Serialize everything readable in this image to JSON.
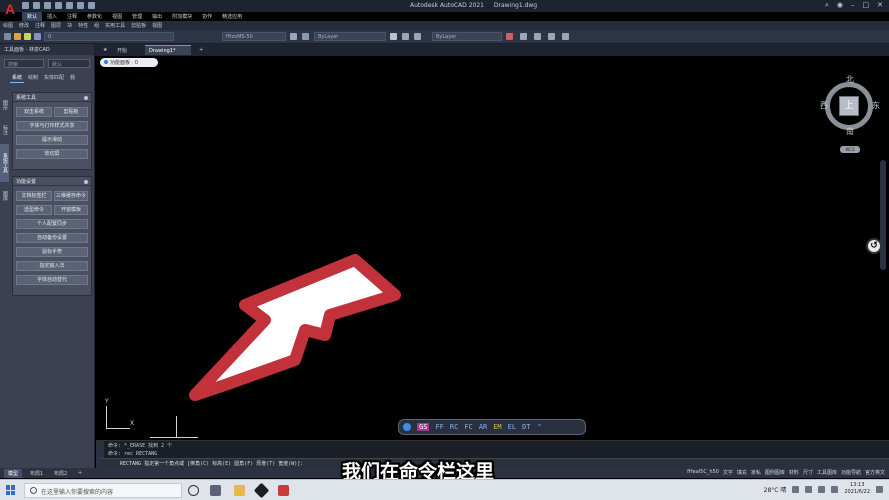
{
  "titlebar": {
    "app_name": "Autodesk AutoCAD 2021",
    "file_name": "Drawing1.dwg",
    "logo": "A"
  },
  "ribbon_tabs": [
    "默认",
    "插入",
    "注释",
    "参数化",
    "视图",
    "管理",
    "输出",
    "附加模块",
    "协作",
    "精选应用"
  ],
  "menubar": [
    "绘图",
    "修改",
    "注释",
    "图层",
    "块",
    "特性",
    "组",
    "实用工具",
    "剪贴板",
    "视图"
  ],
  "toolbar": {
    "layer_field": "0",
    "textstyle_field": "fHzoMS-50",
    "linetype_field": "ByLayer",
    "color_field": "ByLayer"
  },
  "doc_tabs": {
    "start_label": "开始",
    "drawing_label": "Drawing1*",
    "add_label": "+"
  },
  "left_panel": {
    "title": "工具面板 - 林泉CAD",
    "search_placeholder": "搜索",
    "search_default": "默认",
    "tabs": [
      "系统",
      "绘制",
      "实体匹配",
      "我"
    ],
    "side_tabs": [
      "图形",
      "标注",
      "系统工具",
      "图库"
    ],
    "groups": [
      {
        "title": "系统工具",
        "buttons": [
          "双击系统",
          "剪贴板",
          "字体与打印样式共享",
          "提示滑动",
          "软切屏"
        ]
      },
      {
        "title": "功能设置",
        "buttons": [
          "文档标签栏",
          "三维缓存命令",
          "选型命令",
          "开窗模板",
          "个人配置同步",
          "自动备份设置",
          "鼠标手势",
          "指定输入法",
          "字体自动替代"
        ]
      }
    ]
  },
  "canvas": {
    "view_label": "功能面板 · 0",
    "viewcube": {
      "north": "北",
      "south": "南",
      "west": "西",
      "east": "东",
      "face": "上"
    },
    "wcs_label": "WCS",
    "ucs_x": "X",
    "ucs_y": "Y"
  },
  "quickbar": {
    "items": [
      "GS",
      "FF",
      "RC",
      "FC",
      "AR",
      "EM",
      "EL",
      "DT"
    ],
    "active": "GS"
  },
  "command": {
    "history": [
      "命令: *_ERASE 找到 2 个",
      "命令: rec RECTANG"
    ],
    "prompt": "RECTANG 指定第一个角点或 [倒角(C) 标高(E) 圆角(F) 厚度(T) 宽度(W)]:"
  },
  "layout_tabs": [
    "模型",
    "布局1",
    "布局2",
    "+"
  ],
  "status": [
    "fHeal5C_h50",
    "文字",
    "填充",
    "家私",
    "图例图库",
    "材料",
    "尺寸",
    "工具图库",
    "功能导航",
    "官方英文"
  ],
  "subtitle": "我们在命令栏这里",
  "taskbar": {
    "search_placeholder": "在这里输入你要搜索的内容",
    "temperature": "28°C 晴",
    "time": "13:13",
    "date": "2021/6/22"
  },
  "colors": {
    "annotation_arrow_fill": "#ffffff",
    "annotation_arrow_stroke": "#c2323b",
    "accent": "#3c8ee8"
  }
}
